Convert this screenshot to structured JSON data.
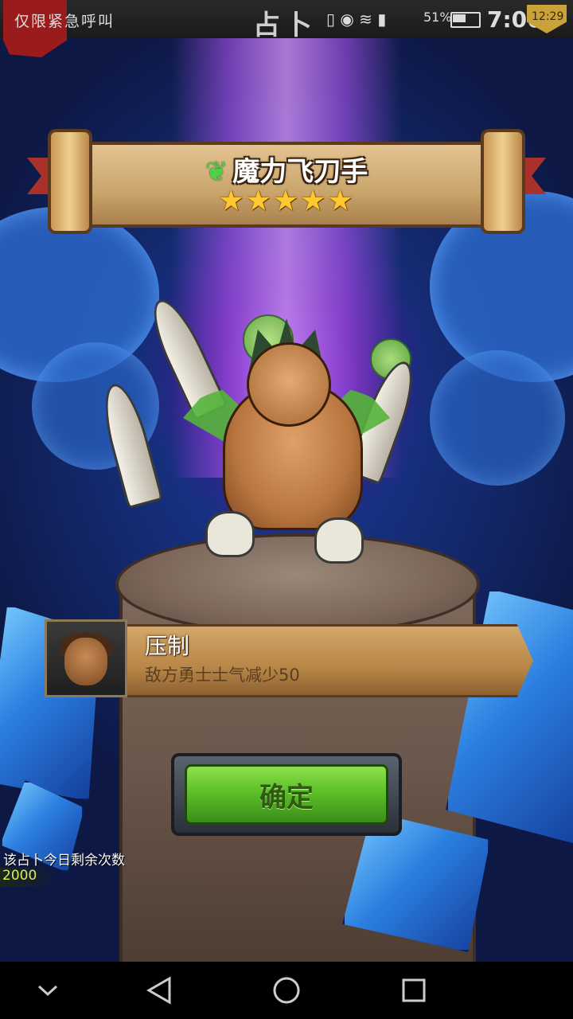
{
  "status_bar": {
    "emergency_text": "仅限紧急呼叫",
    "center_text": "占卜",
    "battery": "51%",
    "time": "7:06",
    "clock_badge": "12:29"
  },
  "hero": {
    "name": "魔力飞刀手",
    "stars_text": "★★★★★",
    "star_rating": 5,
    "element_icon": "leaf-icon"
  },
  "skill": {
    "name": "压制",
    "description": "敌方勇士士气减少50"
  },
  "confirm_button": {
    "label": "确定"
  },
  "remaining": {
    "label": "该占卜今日剩余次数",
    "value": "2000"
  },
  "nav": {
    "back_icon": "back-icon",
    "home_icon": "home-icon",
    "recents_icon": "recents-icon",
    "collapse_icon": "chevron-down-icon"
  },
  "colors": {
    "confirm_green": "#5cc02a",
    "star_gold": "#ffc830",
    "beam_purple": "#b05cff"
  }
}
